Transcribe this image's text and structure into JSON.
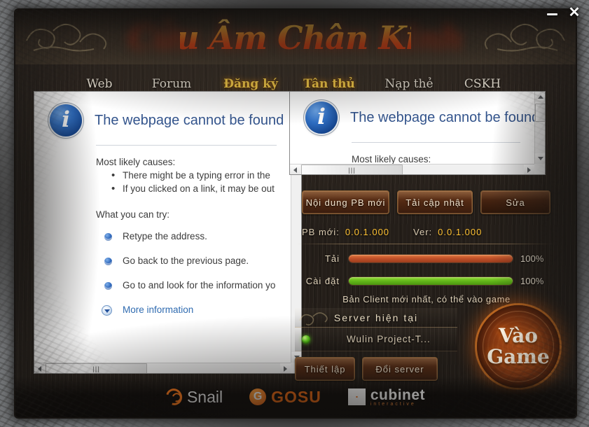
{
  "window": {
    "logo_text": "Cửu Âm Chân Kinh",
    "minimize_label": "–",
    "close_label": "✕"
  },
  "nav": {
    "tabs": [
      {
        "label": "Web",
        "active": false
      },
      {
        "label": "Forum",
        "active": false
      },
      {
        "label": "Đăng ký",
        "active": true
      },
      {
        "label": "Tân thủ",
        "active": true
      },
      {
        "label": "Nạp thẻ",
        "active": false
      },
      {
        "label": "CSKH",
        "active": false
      }
    ]
  },
  "error_page": {
    "icon": "info-icon",
    "title": "The webpage cannot be found",
    "causes_heading": "Most likely causes:",
    "causes": [
      "There might be a typing error in the",
      "If you clicked on a link, it may be out"
    ],
    "try_heading": "What you can try:",
    "actions": [
      "Retype the address.",
      "Go back to the previous page.",
      "Go to  and look for the information yo"
    ],
    "more_information": "More information"
  },
  "error_page_small": {
    "icon": "info-icon",
    "title": "The webpage cannot be found",
    "causes_heading": "Most likely causes:"
  },
  "launcher": {
    "buttons": [
      {
        "label": "Nội dung PB mới",
        "style": "normal"
      },
      {
        "label": "Tải cập nhật",
        "style": "normal"
      },
      {
        "label": "Sửa",
        "style": "dark"
      }
    ],
    "version": {
      "pb_label": "PB mới:",
      "pb_value": "0.0.1.000",
      "ver_label": "Ver:",
      "ver_value": "0.0.1.000"
    },
    "progress": [
      {
        "label": "Tải",
        "percent": "100%",
        "value": 100,
        "color": "#c2522a"
      },
      {
        "label": "Cài đặt",
        "percent": "100%",
        "value": 100,
        "color": "#63b81a"
      }
    ],
    "status_message": "Bản Client mới nhất, có thể vào game",
    "server": {
      "heading": "Server hiện tại",
      "current": "Wulin Project-T...",
      "status_color": "#5ed11c"
    },
    "bottom_buttons": [
      {
        "label": "Thiết lập"
      },
      {
        "label": "Đổi server"
      }
    ],
    "play_button": {
      "line1": "Vào",
      "line2": "Game"
    }
  },
  "footer": {
    "partners": [
      {
        "name": "Snail",
        "mark": "snail-icon"
      },
      {
        "name": "GOSU",
        "mark": "gosu-icon",
        "initial": "G"
      },
      {
        "name": "cubinet",
        "mark": "cubinet-icon",
        "tagline": "interactive"
      }
    ]
  },
  "scrollbar": {
    "grip": "|||"
  }
}
